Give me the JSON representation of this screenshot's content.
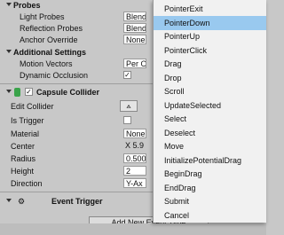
{
  "inspector": {
    "probes_header": "Probes",
    "light_probes": {
      "label": "Light Probes",
      "value": "Blend"
    },
    "reflection_probes": {
      "label": "Reflection Probes",
      "value": "Blend"
    },
    "anchor_override": {
      "label": "Anchor Override",
      "value": "None"
    },
    "additional_header": "Additional Settings",
    "motion_vectors": {
      "label": "Motion Vectors",
      "value": "Per O"
    },
    "dynamic_occlusion": {
      "label": "Dynamic Occlusion",
      "value": "✓"
    },
    "capsule_collider": {
      "title": "Capsule Collider",
      "edit_collider": "Edit Collider",
      "edit_icon": "edit-collider-icon",
      "is_trigger": "Is Trigger",
      "material": {
        "label": "Material",
        "value": "None"
      },
      "center": {
        "label": "Center",
        "value": "X 5.9"
      },
      "radius": {
        "label": "Radius",
        "value": "0.500"
      },
      "height": {
        "label": "Height",
        "value": "2"
      },
      "direction": {
        "label": "Direction",
        "value": "Y-Ax"
      }
    },
    "event_trigger": {
      "title": "Event Trigger"
    },
    "add_new_event_type": "Add New Event Type"
  },
  "dropdown": {
    "items": [
      "PointerExit",
      "PointerDown",
      "PointerUp",
      "PointerClick",
      "Drag",
      "Drop",
      "Scroll",
      "UpdateSelected",
      "Select",
      "Deselect",
      "Move",
      "InitializePotentialDrag",
      "BeginDrag",
      "EndDrag",
      "Submit",
      "Cancel"
    ],
    "selected": "PointerDown",
    "highlight_color": "#99c9ef"
  }
}
